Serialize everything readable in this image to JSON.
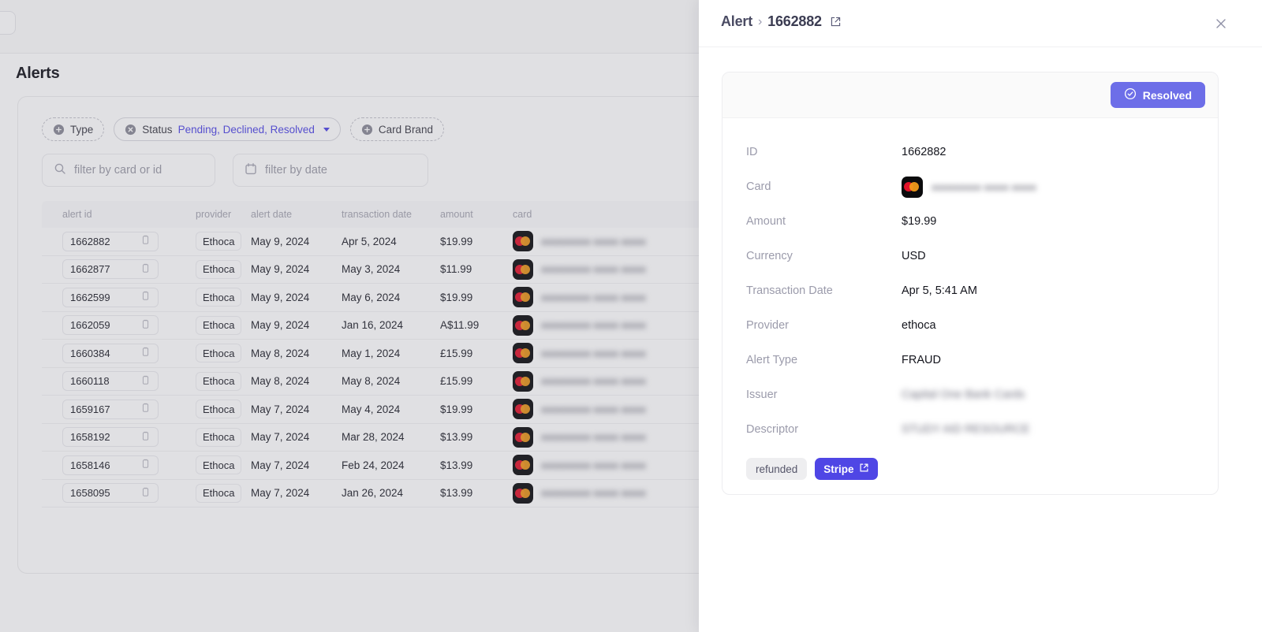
{
  "page": {
    "title": "Alerts"
  },
  "filters": {
    "chips": [
      {
        "label": "Type",
        "icon": "plus-circle-icon",
        "style": "dashed",
        "values": "",
        "has_caret": false
      },
      {
        "label": "Status",
        "icon": "x-circle-icon",
        "style": "solid",
        "values": "Pending, Declined, Resolved",
        "has_caret": true
      },
      {
        "label": "Card Brand",
        "icon": "plus-circle-icon",
        "style": "dashed",
        "values": "",
        "has_caret": false
      }
    ],
    "card_search_placeholder": "filter by card or id",
    "date_search_placeholder": "filter by date",
    "card_search_value": "",
    "date_search_value": "",
    "search_icon": "search-icon",
    "calendar_icon": "calendar-icon"
  },
  "table": {
    "columns": [
      "alert id",
      "provider",
      "alert date",
      "transaction date",
      "amount",
      "card"
    ],
    "rows": [
      {
        "alert_id": "1662882",
        "provider": "Ethoca",
        "alert_date": "May 9, 2024",
        "transaction_date": "Apr 5, 2024",
        "amount": "$19.99",
        "card_brand": "mastercard-icon",
        "card_masked": "●●●●●●●● ●●●● ●●●●"
      },
      {
        "alert_id": "1662877",
        "provider": "Ethoca",
        "alert_date": "May 9, 2024",
        "transaction_date": "May 3, 2024",
        "amount": "$11.99",
        "card_brand": "mastercard-icon",
        "card_masked": "●●●●●●●● ●●●● ●●●●"
      },
      {
        "alert_id": "1662599",
        "provider": "Ethoca",
        "alert_date": "May 9, 2024",
        "transaction_date": "May 6, 2024",
        "amount": "$19.99",
        "card_brand": "mastercard-icon",
        "card_masked": "●●●●●●●● ●●●● ●●●●"
      },
      {
        "alert_id": "1662059",
        "provider": "Ethoca",
        "alert_date": "May 9, 2024",
        "transaction_date": "Jan 16, 2024",
        "amount": "A$11.99",
        "card_brand": "mastercard-icon",
        "card_masked": "●●●●●●●● ●●●● ●●●●"
      },
      {
        "alert_id": "1660384",
        "provider": "Ethoca",
        "alert_date": "May 8, 2024",
        "transaction_date": "May 1, 2024",
        "amount": "£15.99",
        "card_brand": "mastercard-icon",
        "card_masked": "●●●●●●●● ●●●● ●●●●"
      },
      {
        "alert_id": "1660118",
        "provider": "Ethoca",
        "alert_date": "May 8, 2024",
        "transaction_date": "May 8, 2024",
        "amount": "£15.99",
        "card_brand": "mastercard-icon",
        "card_masked": "●●●●●●●● ●●●● ●●●●"
      },
      {
        "alert_id": "1659167",
        "provider": "Ethoca",
        "alert_date": "May 7, 2024",
        "transaction_date": "May 4, 2024",
        "amount": "$19.99",
        "card_brand": "mastercard-icon",
        "card_masked": "●●●●●●●● ●●●● ●●●●"
      },
      {
        "alert_id": "1658192",
        "provider": "Ethoca",
        "alert_date": "May 7, 2024",
        "transaction_date": "Mar 28, 2024",
        "amount": "$13.99",
        "card_brand": "mastercard-icon",
        "card_masked": "●●●●●●●● ●●●● ●●●●"
      },
      {
        "alert_id": "1658146",
        "provider": "Ethoca",
        "alert_date": "May 7, 2024",
        "transaction_date": "Feb 24, 2024",
        "amount": "$13.99",
        "card_brand": "mastercard-icon",
        "card_masked": "●●●●●●●● ●●●● ●●●●"
      },
      {
        "alert_id": "1658095",
        "provider": "Ethoca",
        "alert_date": "May 7, 2024",
        "transaction_date": "Jan 26, 2024",
        "amount": "$13.99",
        "card_brand": "mastercard-icon",
        "card_masked": "●●●●●●●● ●●●● ●●●●"
      }
    ],
    "copy_icon": "copy-icon"
  },
  "panel": {
    "breadcrumb_root": "Alert",
    "breadcrumb_sep": "›",
    "breadcrumb_id": "1662882",
    "external_link_icon": "external-link-icon",
    "close_icon": "close-icon",
    "status_button": {
      "label": "Resolved",
      "icon": "check-circle-icon"
    },
    "fields": [
      {
        "label": "ID",
        "value": "1662882",
        "blurred": false,
        "type": "text"
      },
      {
        "label": "Card",
        "value": "●●●●●●●● ●●●● ●●●●",
        "blurred": true,
        "type": "card"
      },
      {
        "label": "Amount",
        "value": "$19.99",
        "blurred": false,
        "type": "text"
      },
      {
        "label": "Currency",
        "value": "USD",
        "blurred": false,
        "type": "text"
      },
      {
        "label": "Transaction Date",
        "value": "Apr 5, 5:41 AM",
        "blurred": false,
        "type": "text"
      },
      {
        "label": "Provider",
        "value": "ethoca",
        "blurred": false,
        "type": "text"
      },
      {
        "label": "Alert Type",
        "value": "FRAUD",
        "blurred": false,
        "type": "text"
      },
      {
        "label": "Issuer",
        "value": "Capital One Bank Cards",
        "blurred": true,
        "type": "text"
      },
      {
        "label": "Descriptor",
        "value": "STUDY AID RESOURCE",
        "blurred": true,
        "type": "text"
      }
    ],
    "tag": "refunded",
    "stripe_button": {
      "label": "Stripe",
      "icon": "external-link-icon"
    }
  },
  "colors": {
    "accent": "#4f46e5",
    "status_button": "#6d6ee8",
    "muted_text": "#9b9bab",
    "text": "#14151d"
  }
}
